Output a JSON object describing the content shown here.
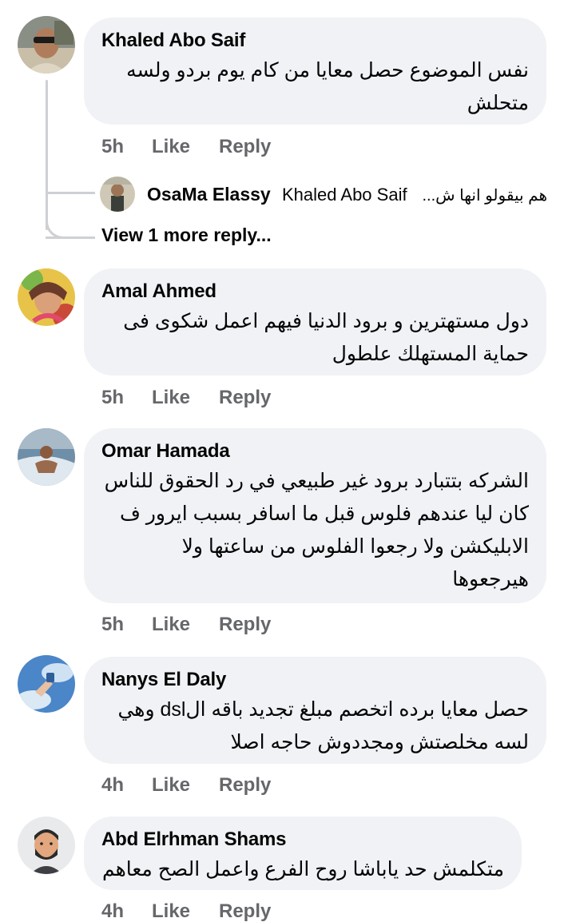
{
  "comments": [
    {
      "author": "Khaled Abo Saif",
      "text": "نفس الموضوع حصل معايا من كام يوم بردو ولسه متحلش",
      "time": "5h",
      "like": "Like",
      "reply": "Reply"
    },
    {
      "author": "Amal Ahmed",
      "text": "دول مستهترين و برود الدنيا فيهم اعمل شكوى فى حماية المستهلك علطول",
      "time": "5h",
      "like": "Like",
      "reply": "Reply"
    },
    {
      "author": "Omar Hamada",
      "text": "الشركه بتتبارد برود غير طبيعي في رد الحقوق للناس كان ليا عندهم فلوس قبل ما اسافر بسبب ايرور ف الابليكشن ولا رجعوا الفلوس من ساعتها ولا هيرجعوها",
      "time": "5h",
      "like": "Like",
      "reply": "Reply"
    },
    {
      "author": "Nanys El Daly",
      "text": "حصل معايا برده اتخصم مبلغ تجديد باقه الdsl وهي لسه مخلصتش ومجددوش حاجه اصلا",
      "time": "4h",
      "like": "Like",
      "reply": "Reply"
    },
    {
      "author": "Abd Elrhman Shams",
      "text": "متكلمش حد ياباشا روح الفرع واعمل الصح معاهم",
      "time": "4h",
      "like": "Like",
      "reply": "Reply"
    }
  ],
  "reply_preview": {
    "author": "OsaMa Elassy",
    "mention": "Khaled Abo Saif",
    "snippet": "هم بيقولو انها ش..."
  },
  "view_more": "View 1 more reply...",
  "colors": {
    "bubble": "#f0f2f5",
    "text": "#050505",
    "secondary": "#65676b",
    "thread_line": "#ced0d4"
  }
}
